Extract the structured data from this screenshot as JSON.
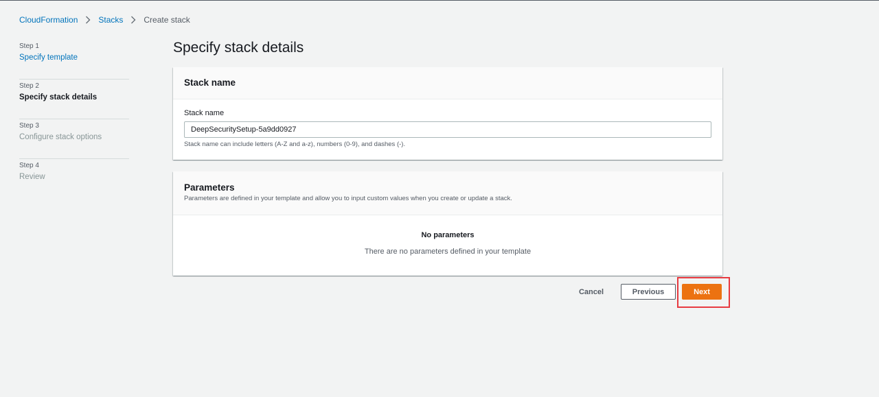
{
  "breadcrumb": {
    "items": [
      {
        "label": "CloudFormation"
      },
      {
        "label": "Stacks"
      },
      {
        "label": "Create stack"
      }
    ]
  },
  "steps": [
    {
      "number": "Step 1",
      "title": "Specify template",
      "state": "done"
    },
    {
      "number": "Step 2",
      "title": "Specify stack details",
      "state": "current"
    },
    {
      "number": "Step 3",
      "title": "Configure stack options",
      "state": "disabled"
    },
    {
      "number": "Step 4",
      "title": "Review",
      "state": "disabled"
    }
  ],
  "page": {
    "title": "Specify stack details"
  },
  "stack_name": {
    "header": "Stack name",
    "field_label": "Stack name",
    "value": "DeepSecuritySetup-5a9dd0927",
    "hint": "Stack name can include letters (A-Z and a-z), numbers (0-9), and dashes (-)."
  },
  "parameters": {
    "header": "Parameters",
    "description": "Parameters are defined in your template and allow you to input custom values when you create or update a stack.",
    "empty_title": "No parameters",
    "empty_description": "There are no parameters defined in your template"
  },
  "actions": {
    "cancel": "Cancel",
    "previous": "Previous",
    "next": "Next"
  },
  "colors": {
    "link": "#0073bb",
    "primary_button": "#ec7211",
    "highlight": "#e7393f",
    "background": "#f2f3f3"
  }
}
